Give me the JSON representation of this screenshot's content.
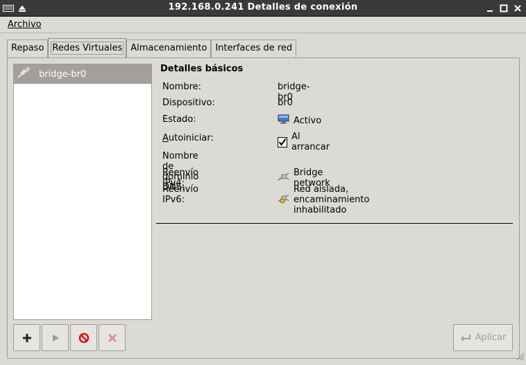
{
  "window": {
    "title": "192.168.0.241 Detalles de conexión"
  },
  "menu": {
    "file": "Archivo"
  },
  "tabs": [
    {
      "label": "Repaso"
    },
    {
      "label": "Redes Virtuales"
    },
    {
      "label": "Almacenamiento"
    },
    {
      "label": "Interfaces de red"
    }
  ],
  "networks": [
    {
      "name": "bridge-br0"
    }
  ],
  "details": {
    "section_title": "Detalles básicos",
    "name_label": "Nombre:",
    "name_value": "bridge-br0",
    "device_label": "Dispositivo:",
    "device_value": "br0",
    "state_label": "Estado:",
    "state_value": "Activo",
    "autostart_label": "Autoiniciar:",
    "autostart_value": "Al arrancar",
    "autostart_checked": true,
    "dns_label": "Nombre de dominio DNS:",
    "dns_value": "",
    "ipv4_label": "Reenvío IPv4:",
    "ipv4_value": "Bridge network",
    "ipv6_label": "Reenvío IPv6:",
    "ipv6_value": "Red aislada, encaminamiento inhabilitado"
  },
  "buttons": {
    "apply": "Aplicar"
  }
}
